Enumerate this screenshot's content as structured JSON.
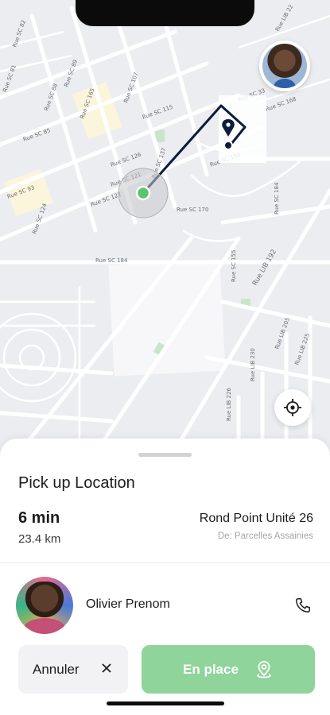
{
  "map": {
    "street_labels": [
      "Rue SC 81",
      "Rue SC 85",
      "Rue SC 88",
      "Rue SC 82",
      "Rue SC 89",
      "Rue SC 165",
      "Rue SC 107",
      "Rue SC 126",
      "Rue SC 115",
      "Rue SC 121",
      "Rue SC 93",
      "Rue SC 124",
      "Rue SC 122",
      "Rue SC 137",
      "Rue SC 170",
      "Rue SC 184",
      "Rue SC 155",
      "Rue SC 33",
      "Rue SC 168",
      "Rue SC 184",
      "Rue SC 150",
      "Rue LIB 192",
      "Rue LIB 22",
      "Rue LIB 226",
      "Rue LIB 230",
      "Rue LIB 205",
      "Rue LIB 225"
    ],
    "accent_color": "#0f1b3d",
    "origin_color": "#5cc46b"
  },
  "top_avatar": {
    "icon": "user-avatar"
  },
  "locate": {
    "icon": "crosshair-icon"
  },
  "sheet": {
    "title": "Pick up Location",
    "eta": "6 min",
    "distance": "23.4 km",
    "destination": "Rond Point Unité 26",
    "destination_sub": "De: Parcelles Assainies"
  },
  "driver": {
    "name": "Olivier Prenom",
    "phone_icon": "phone-icon"
  },
  "actions": {
    "cancel_label": "Annuler",
    "confirm_label": "En place",
    "confirm_color": "#8fd49b"
  }
}
